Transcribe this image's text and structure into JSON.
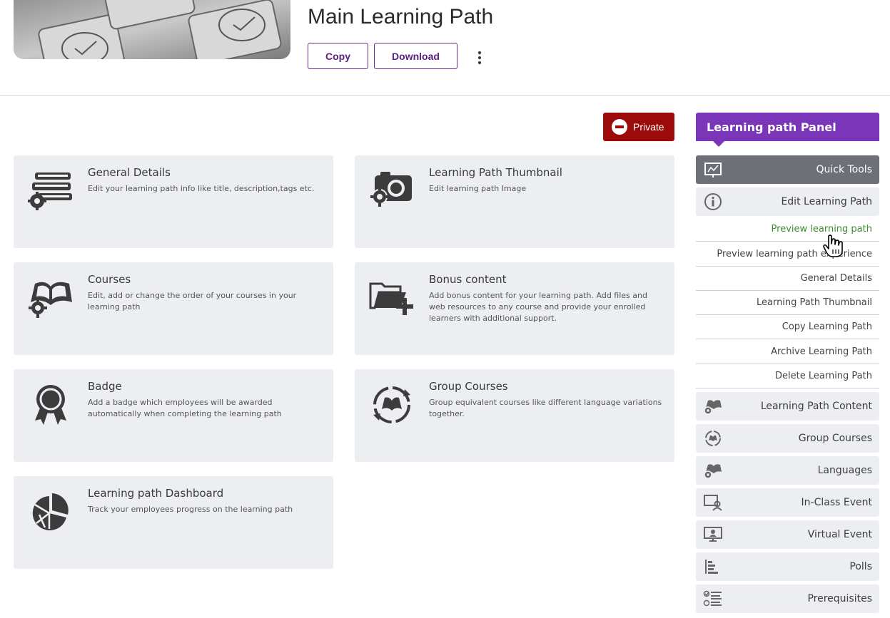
{
  "header": {
    "title": "Main Learning Path",
    "copy_label": "Copy",
    "download_label": "Download"
  },
  "visibility": {
    "label": "Private"
  },
  "cards": [
    {
      "title": "General Details",
      "desc": "Edit your learning path info like title, description,tags etc.",
      "icon": "books-gear-icon"
    },
    {
      "title": "Learning Path Thumbnail",
      "desc": "Edit learning path Image",
      "icon": "camera-gear-icon"
    },
    {
      "title": "Courses",
      "desc": "Edit, add or change the order of your courses in your learning path",
      "icon": "book-gear-icon"
    },
    {
      "title": "Bonus content",
      "desc": "Add bonus content for your learning path. Add files and web resources to any course and provide your enrolled learners with additional support.",
      "icon": "folder-plus-icon"
    },
    {
      "title": "Badge",
      "desc": "Add a badge which employees will be awarded automatically when completing the learning path",
      "icon": "badge-ribbon-icon"
    },
    {
      "title": "Group Courses",
      "desc": "Group equivalent courses like different language variations together.",
      "icon": "book-cycle-icon"
    },
    {
      "title": "Learning path Dashboard",
      "desc": "Track your employees progress on the learning path",
      "icon": "pie-chart-icon"
    }
  ],
  "panel": {
    "title": "Learning path Panel",
    "quick_tools": "Quick Tools",
    "edit_learning_path": "Edit Learning Path",
    "sub_items": [
      "Preview learning path",
      "Preview learning path experience",
      "General Details",
      "Learning Path Thumbnail",
      "Copy Learning Path",
      "Archive Learning Path",
      "Delete Learning Path"
    ],
    "tools": [
      "Learning Path Content",
      "Group Courses",
      "Languages",
      "In-Class Event",
      "Virtual Event",
      "Polls",
      "Prerequisites"
    ]
  },
  "colors": {
    "accent": "#7b35b8",
    "button_text": "#5b2380",
    "private": "#9c0a0a",
    "active_link": "#3d8c2e",
    "card_bg": "#eceef1",
    "quick_tools_bg": "#6d7077"
  }
}
